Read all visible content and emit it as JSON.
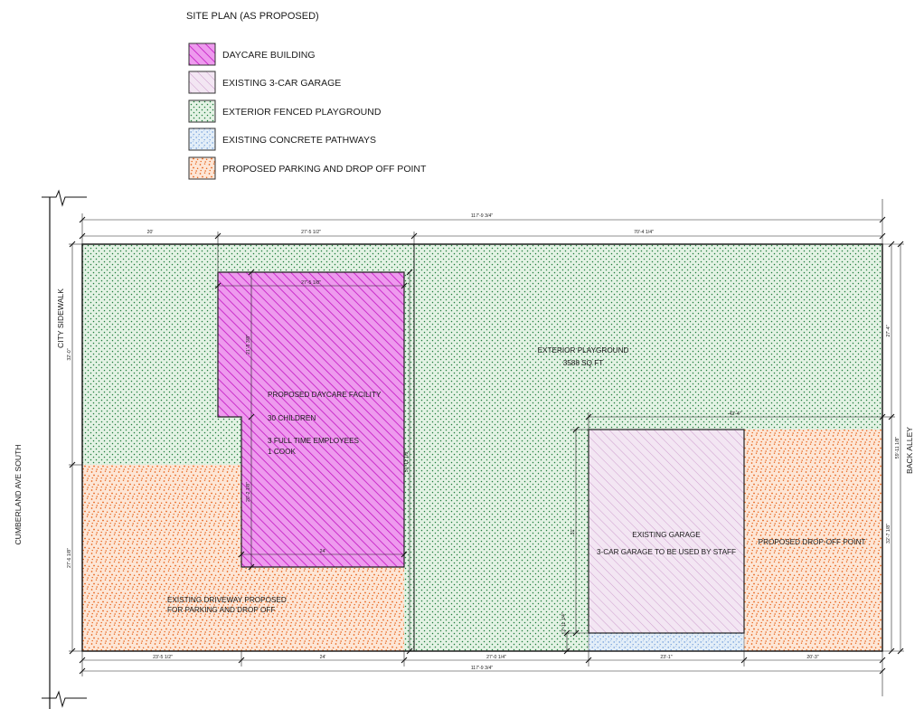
{
  "title": "SITE PLAN (AS PROPOSED)",
  "legend": [
    {
      "key": "daycare",
      "label": "DAYCARE BUILDING"
    },
    {
      "key": "garage",
      "label": "EXISTING 3-CAR GARAGE"
    },
    {
      "key": "playground",
      "label": "EXTERIOR FENCED PLAYGROUND"
    },
    {
      "key": "pathway",
      "label": "EXISTING CONCRETE PATHWAYS"
    },
    {
      "key": "parking",
      "label": "PROPOSED PARKING AND DROP OFF POINT"
    }
  ],
  "streets": {
    "left": "CUMBERLAND AVE SOUTH",
    "sidewalk": "CITY SIDEWALK",
    "right": "BACK ALLEY"
  },
  "areas": {
    "playground": {
      "name": "EXTERIOR PLAYGROUND",
      "size": "3588 SQ FT"
    },
    "daycare": {
      "name": "PROPOSED DAYCARE FACILITY",
      "children": "30 CHILDREN",
      "employees": "3 FULL TIME EMPLOYEES",
      "cook": "1 COOK"
    },
    "garage": {
      "name": "EXISTING GARAGE",
      "note": "3-CAR GARAGE TO BE USED BY STAFF"
    },
    "driveway": {
      "line1": "EXISTING DRIVEWAY PROPOSED",
      "line2": "FOR PARKING AND DROP OFF"
    },
    "dropoff": {
      "name": "PROPOSED DROP-OFF POINT"
    }
  },
  "dimensions": {
    "top_total": "117'-9 3/4\"",
    "top_a": "20'",
    "top_b": "27'-5 1/2\"",
    "top_c": "70'-4 1/4\"",
    "bottom_a": "23'-5 1/2\"",
    "bottom_b": "24'",
    "bottom_c": "27'-0 1/4\"",
    "bottom_d": "23'-1\"",
    "bottom_e": "20'-3\"",
    "bottom_total": "117'-9 3/4\"",
    "left_upper": "32'-0\"",
    "left_lower": "27'-6 1/8\"",
    "right_upper": "27'-4\"",
    "right_lower": "32'-7 1/8\"",
    "right_total": "59'-11 1/8\"",
    "building_top": "27'-5 1/8\"",
    "building_left_upper": "21'-5 3/8\"",
    "building_left_lower": "20'-2 1/8\"",
    "building_bottom": "24'",
    "building_right": "50'-11 1/8\"",
    "garage_top": "42'-4\"",
    "garage_left": "31'",
    "garage_pathway": "2'-11 1/4\""
  },
  "colors": {
    "daycare_fill": "#ee9aee",
    "daycare_hatch": "#c214c2",
    "garage_fill": "#f3e6f3",
    "garage_hatch": "#c48cc4",
    "playground_fill": "#e3f2e4",
    "playground_dot": "#1e7c3a",
    "pathway_fill": "#e3eef8",
    "pathway_dot": "#5d8fd6",
    "parking_fill": "#fde6d6",
    "parking_dot": "#e8641b"
  }
}
